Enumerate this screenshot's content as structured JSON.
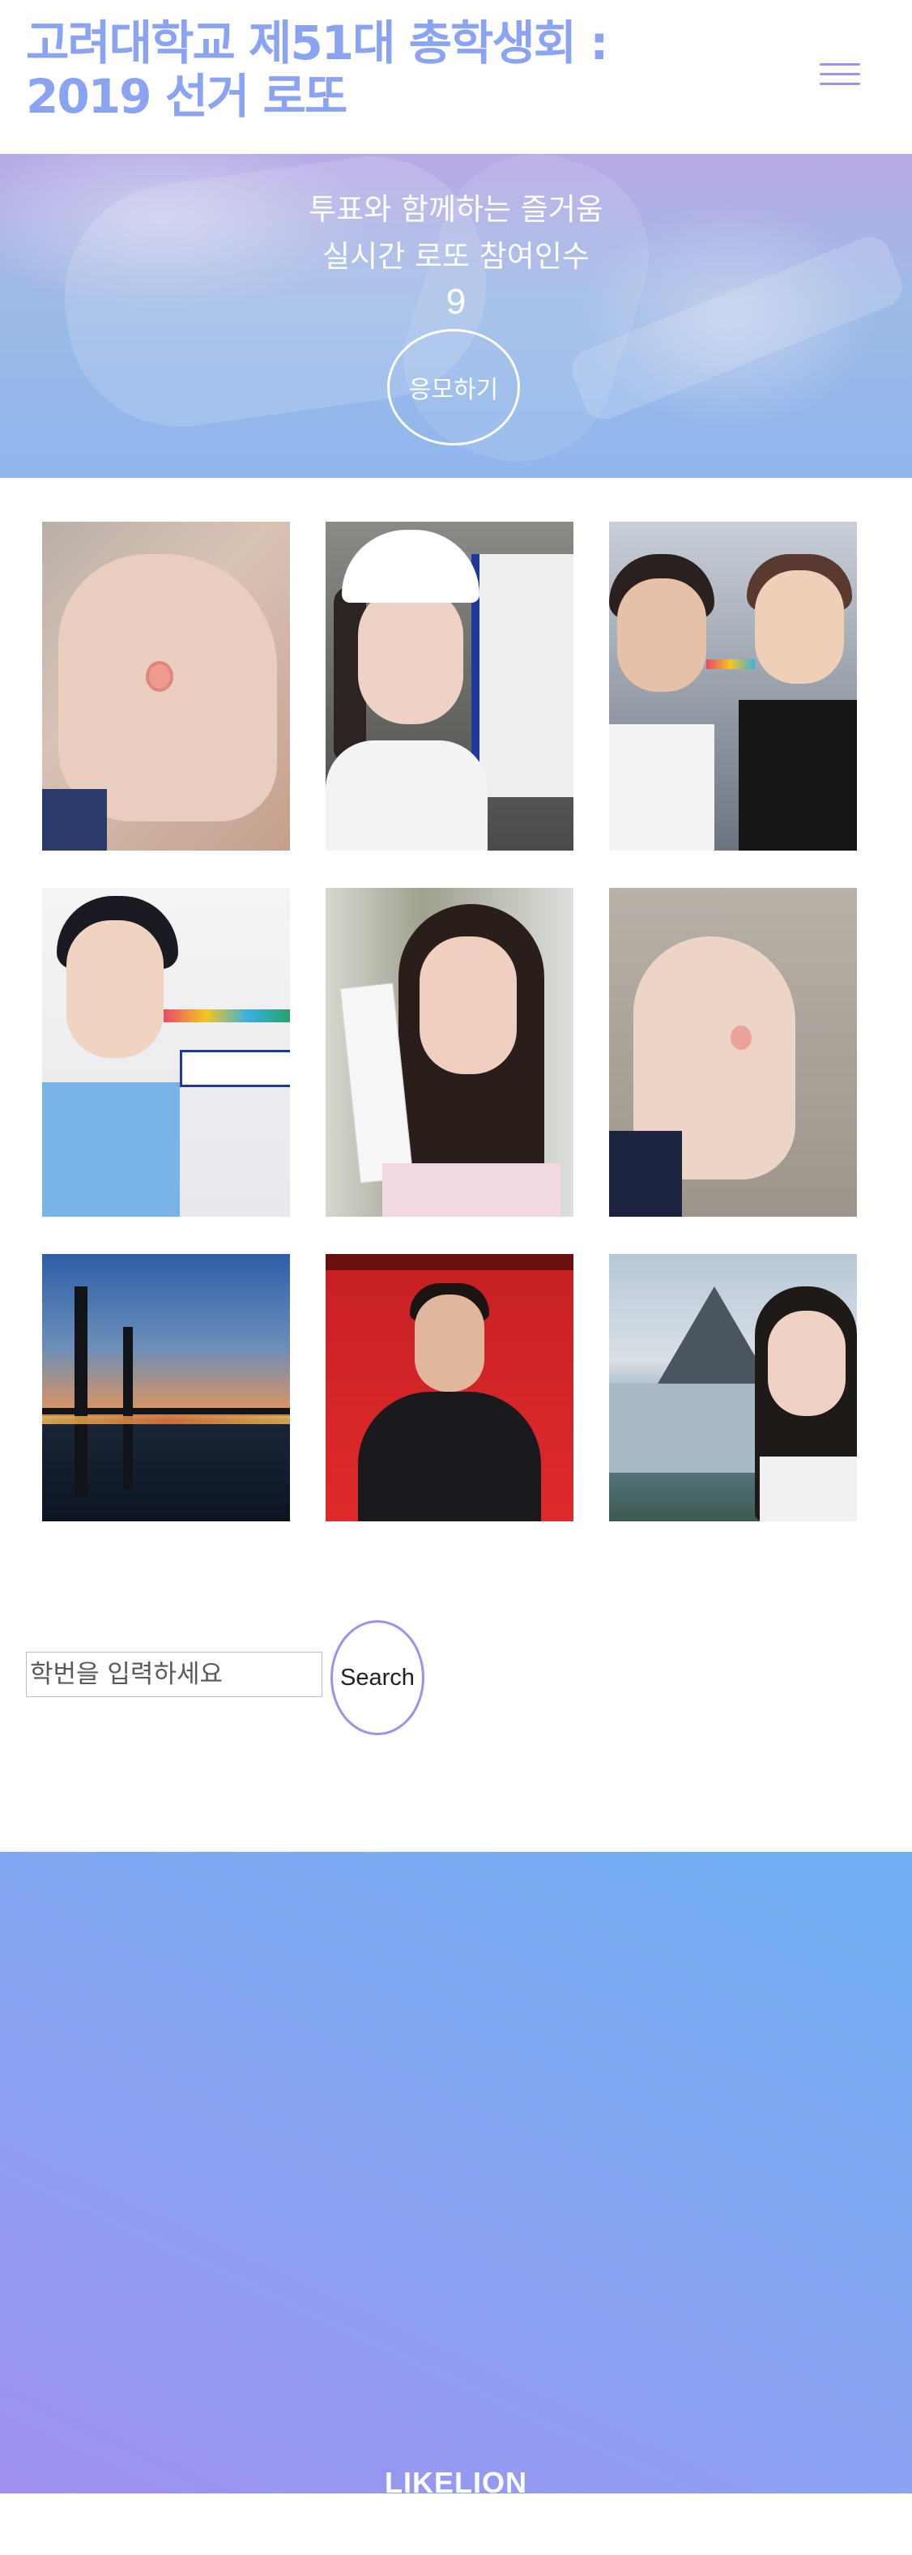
{
  "header": {
    "title": "고려대학교 제51대 총학생회 : 2019 선거 로또",
    "menu_icon": "hamburger-menu-icon"
  },
  "hero": {
    "line1": "투표와 함께하는 즐거움",
    "line2": "실시간 로또 참여인수",
    "participant_count": "9",
    "apply_label": "응모하기"
  },
  "gallery": {
    "count": 9
  },
  "search": {
    "placeholder": "학번을 입력하세요",
    "value": "",
    "button_label": "Search"
  },
  "footer": {
    "logo_text": "LIKELION"
  },
  "colors": {
    "accent": "#9a92ee",
    "title": "#8aa3f2",
    "footer_start": "#9f90ef",
    "footer_end": "#70b0f2"
  }
}
